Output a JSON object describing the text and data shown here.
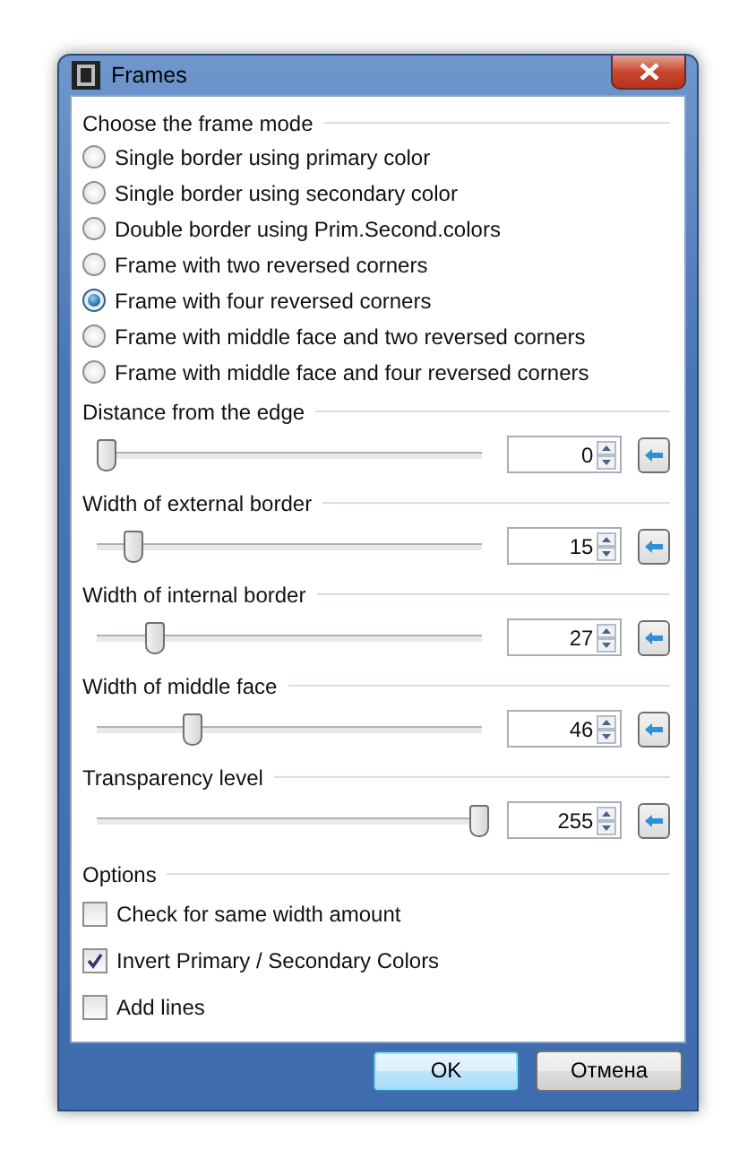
{
  "window": {
    "title": "Frames"
  },
  "frame_mode": {
    "label": "Choose the frame mode",
    "options": [
      {
        "label": "Single border using primary color",
        "selected": false
      },
      {
        "label": "Single border using secondary color",
        "selected": false
      },
      {
        "label": "Double border using Prim.Second.colors",
        "selected": false
      },
      {
        "label": "Frame with two reversed corners",
        "selected": false
      },
      {
        "label": "Frame with four reversed corners",
        "selected": true
      },
      {
        "label": "Frame with middle face and two reversed corners",
        "selected": false
      },
      {
        "label": "Frame with middle face and four reversed corners",
        "selected": false
      }
    ]
  },
  "sliders": [
    {
      "label": "Distance from the edge",
      "level": 0,
      "value": "0"
    },
    {
      "label": "Width of external border",
      "level": 0.07,
      "value": "15"
    },
    {
      "label": "Width of internal border",
      "level": 0.13,
      "value": "27"
    },
    {
      "label": "Width of middle face",
      "level": 0.23,
      "value": "46"
    },
    {
      "label": "Transparency level",
      "level": 1,
      "value": "255"
    }
  ],
  "options": {
    "label": "Options",
    "items": [
      {
        "label": "Check for same width amount",
        "checked": false
      },
      {
        "label": "Invert Primary / Secondary Colors",
        "checked": true
      },
      {
        "label": "Add lines",
        "checked": false
      }
    ]
  },
  "buttons": [
    {
      "label": "OK",
      "default": true
    },
    {
      "label": "Отмена",
      "default": false
    }
  ]
}
